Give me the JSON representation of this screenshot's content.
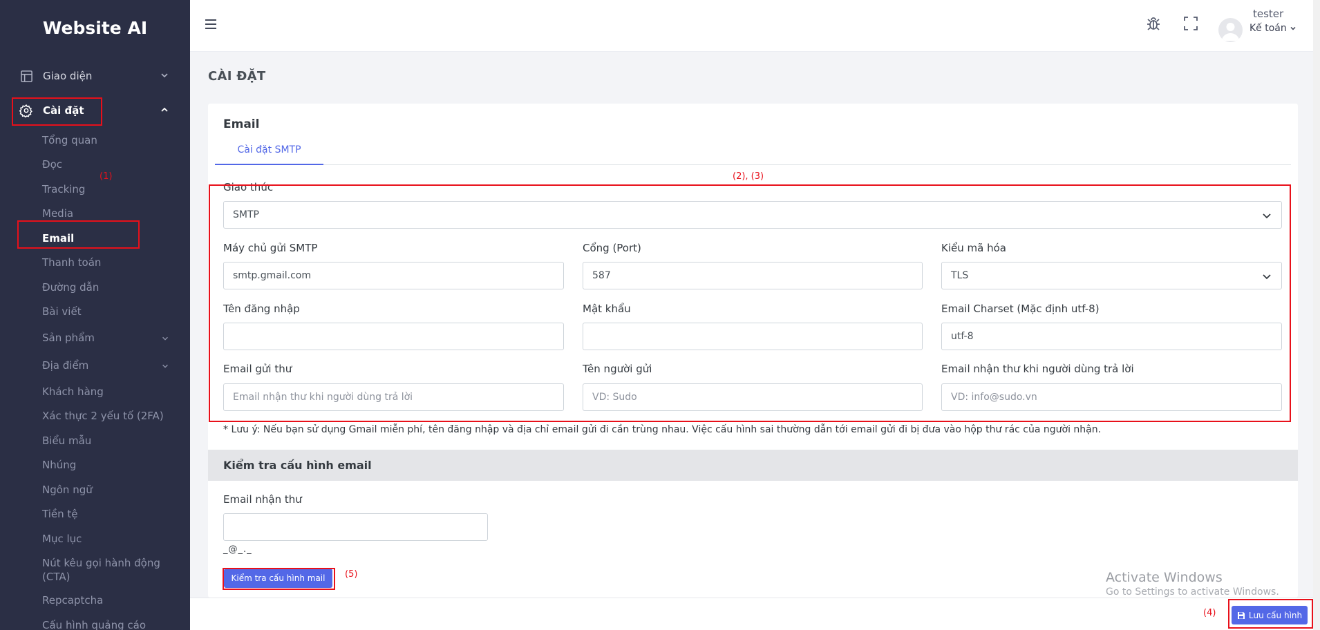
{
  "app": {
    "brand": "Website AI"
  },
  "sidebar": {
    "groups": [
      {
        "label": "Giao diện",
        "icon": "layout-icon"
      },
      {
        "label": "Cài đặt",
        "icon": "gear-icon"
      }
    ],
    "items": [
      {
        "label": "Tổng quan"
      },
      {
        "label": "Đọc"
      },
      {
        "label": "Tracking"
      },
      {
        "label": "Media"
      },
      {
        "label": "Email"
      },
      {
        "label": "Thanh toán"
      },
      {
        "label": "Đường dẫn"
      },
      {
        "label": "Bài viết"
      },
      {
        "label": "Sản phẩm"
      },
      {
        "label": "Địa điểm"
      },
      {
        "label": "Khách hàng"
      },
      {
        "label": "Xác thực 2 yếu tố (2FA)"
      },
      {
        "label": "Biểu mẫu"
      },
      {
        "label": "Nhúng"
      },
      {
        "label": "Ngôn ngữ"
      },
      {
        "label": "Tiền tệ"
      },
      {
        "label": "Mục lục"
      },
      {
        "label": "Nút kêu gọi hành động (CTA)"
      },
      {
        "label": "Repcaptcha"
      },
      {
        "label": "Cấu hình quảng cáo"
      }
    ]
  },
  "topbar": {
    "user_name": "tester",
    "user_role": "Kế toán",
    "icons": [
      "menu-icon",
      "bug-icon",
      "fullscreen-icon",
      "avatar",
      "chevron-down-icon"
    ]
  },
  "page": {
    "title": "CÀI ĐẶT"
  },
  "email_card": {
    "title": "Email",
    "tab": "Cài đặt SMTP",
    "protocol": {
      "label": "Giao thức",
      "value": "SMTP"
    },
    "smtp_host": {
      "label": "Máy chủ gửi SMTP",
      "value": "smtp.gmail.com"
    },
    "port": {
      "label": "Cổng (Port)",
      "value": "587"
    },
    "encryption": {
      "label": "Kiểu mã hóa",
      "value": "TLS"
    },
    "username": {
      "label": "Tên đăng nhập",
      "value": ""
    },
    "password": {
      "label": "Mật khẩu",
      "value": ""
    },
    "charset": {
      "label": "Email Charset (Mặc định utf-8)",
      "value": "utf-8"
    },
    "sender_email": {
      "label": "Email gửi thư",
      "placeholder": "Email nhận thư khi người dùng trả lời"
    },
    "sender_name": {
      "label": "Tên người gửi",
      "placeholder": "VD: Sudo"
    },
    "reply_email": {
      "label": "Email nhận thư khi người dùng trả lời",
      "placeholder": "VD: info@sudo.vn"
    },
    "note": "* Lưu ý: Nếu bạn sử dụng Gmail miễn phí, tên đăng nhập và địa chỉ email gửi đi cần trùng nhau. Việc cấu hình sai thường dẫn tới email gửi đi bị đưa vào hộp thư rác của người nhận."
  },
  "test_section": {
    "title": "Kiểm tra cấu hình email",
    "recipient_label": "Email nhận thư",
    "hint": "_@_._",
    "button": "Kiểm tra cấu hình mail"
  },
  "footer": {
    "save_button": "Lưu cấu hình"
  },
  "annotations": {
    "n1": "(1)",
    "n23": "(2), (3)",
    "n4": "(4)",
    "n5": "(5)",
    "color": "#e8101a"
  },
  "watermark": {
    "line1": "Activate Windows",
    "line2": "Go to Settings to activate Windows."
  },
  "colors": {
    "sidebar_bg": "#2b2f45",
    "accent": "#5368e7",
    "annotation_red": "#e8101a"
  }
}
